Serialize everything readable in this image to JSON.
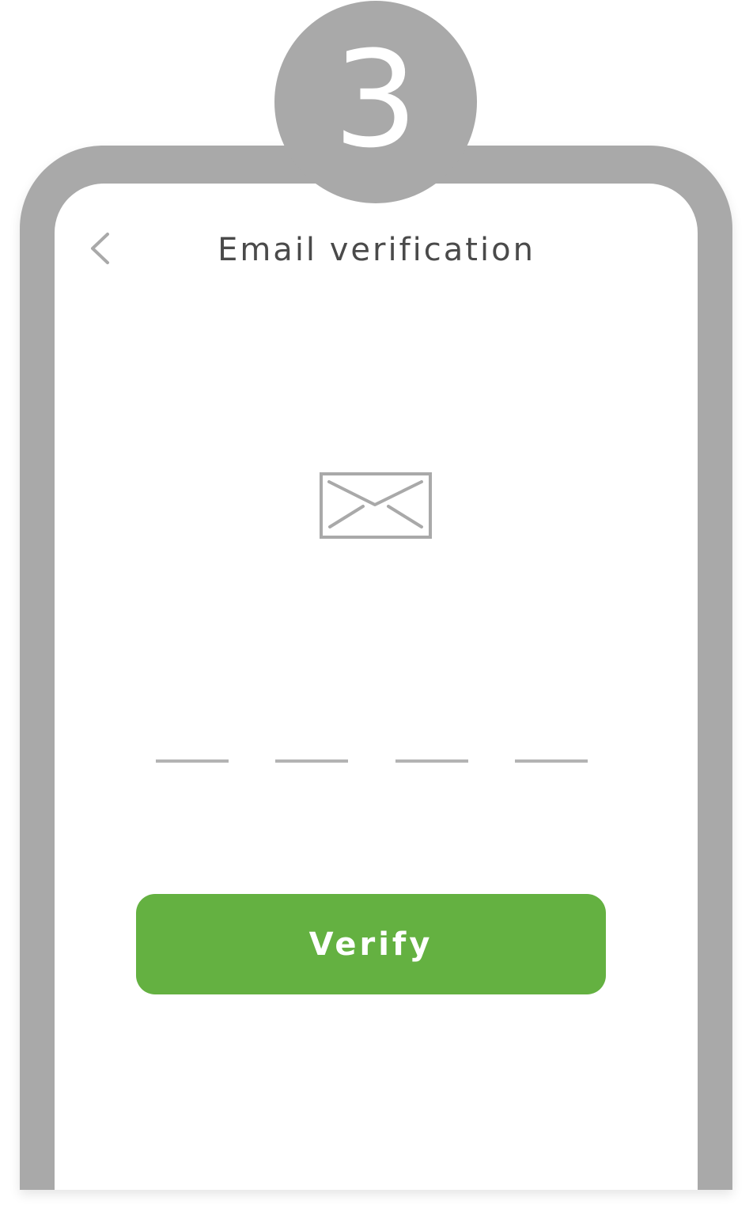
{
  "step": {
    "number": "3"
  },
  "header": {
    "back_icon": "chevron-left-icon",
    "title": "Email verification"
  },
  "main": {
    "illustration_icon": "envelope-icon",
    "code_input": {
      "slot_count": 4,
      "values": [
        "",
        "",
        "",
        ""
      ]
    },
    "verify_label": "Verify"
  },
  "colors": {
    "frame": "#a9a9a9",
    "accent": "#64b141",
    "title_text": "#4a4a4a",
    "icon_stroke": "#a9a9a9",
    "slot_line": "#b3b3b3"
  }
}
